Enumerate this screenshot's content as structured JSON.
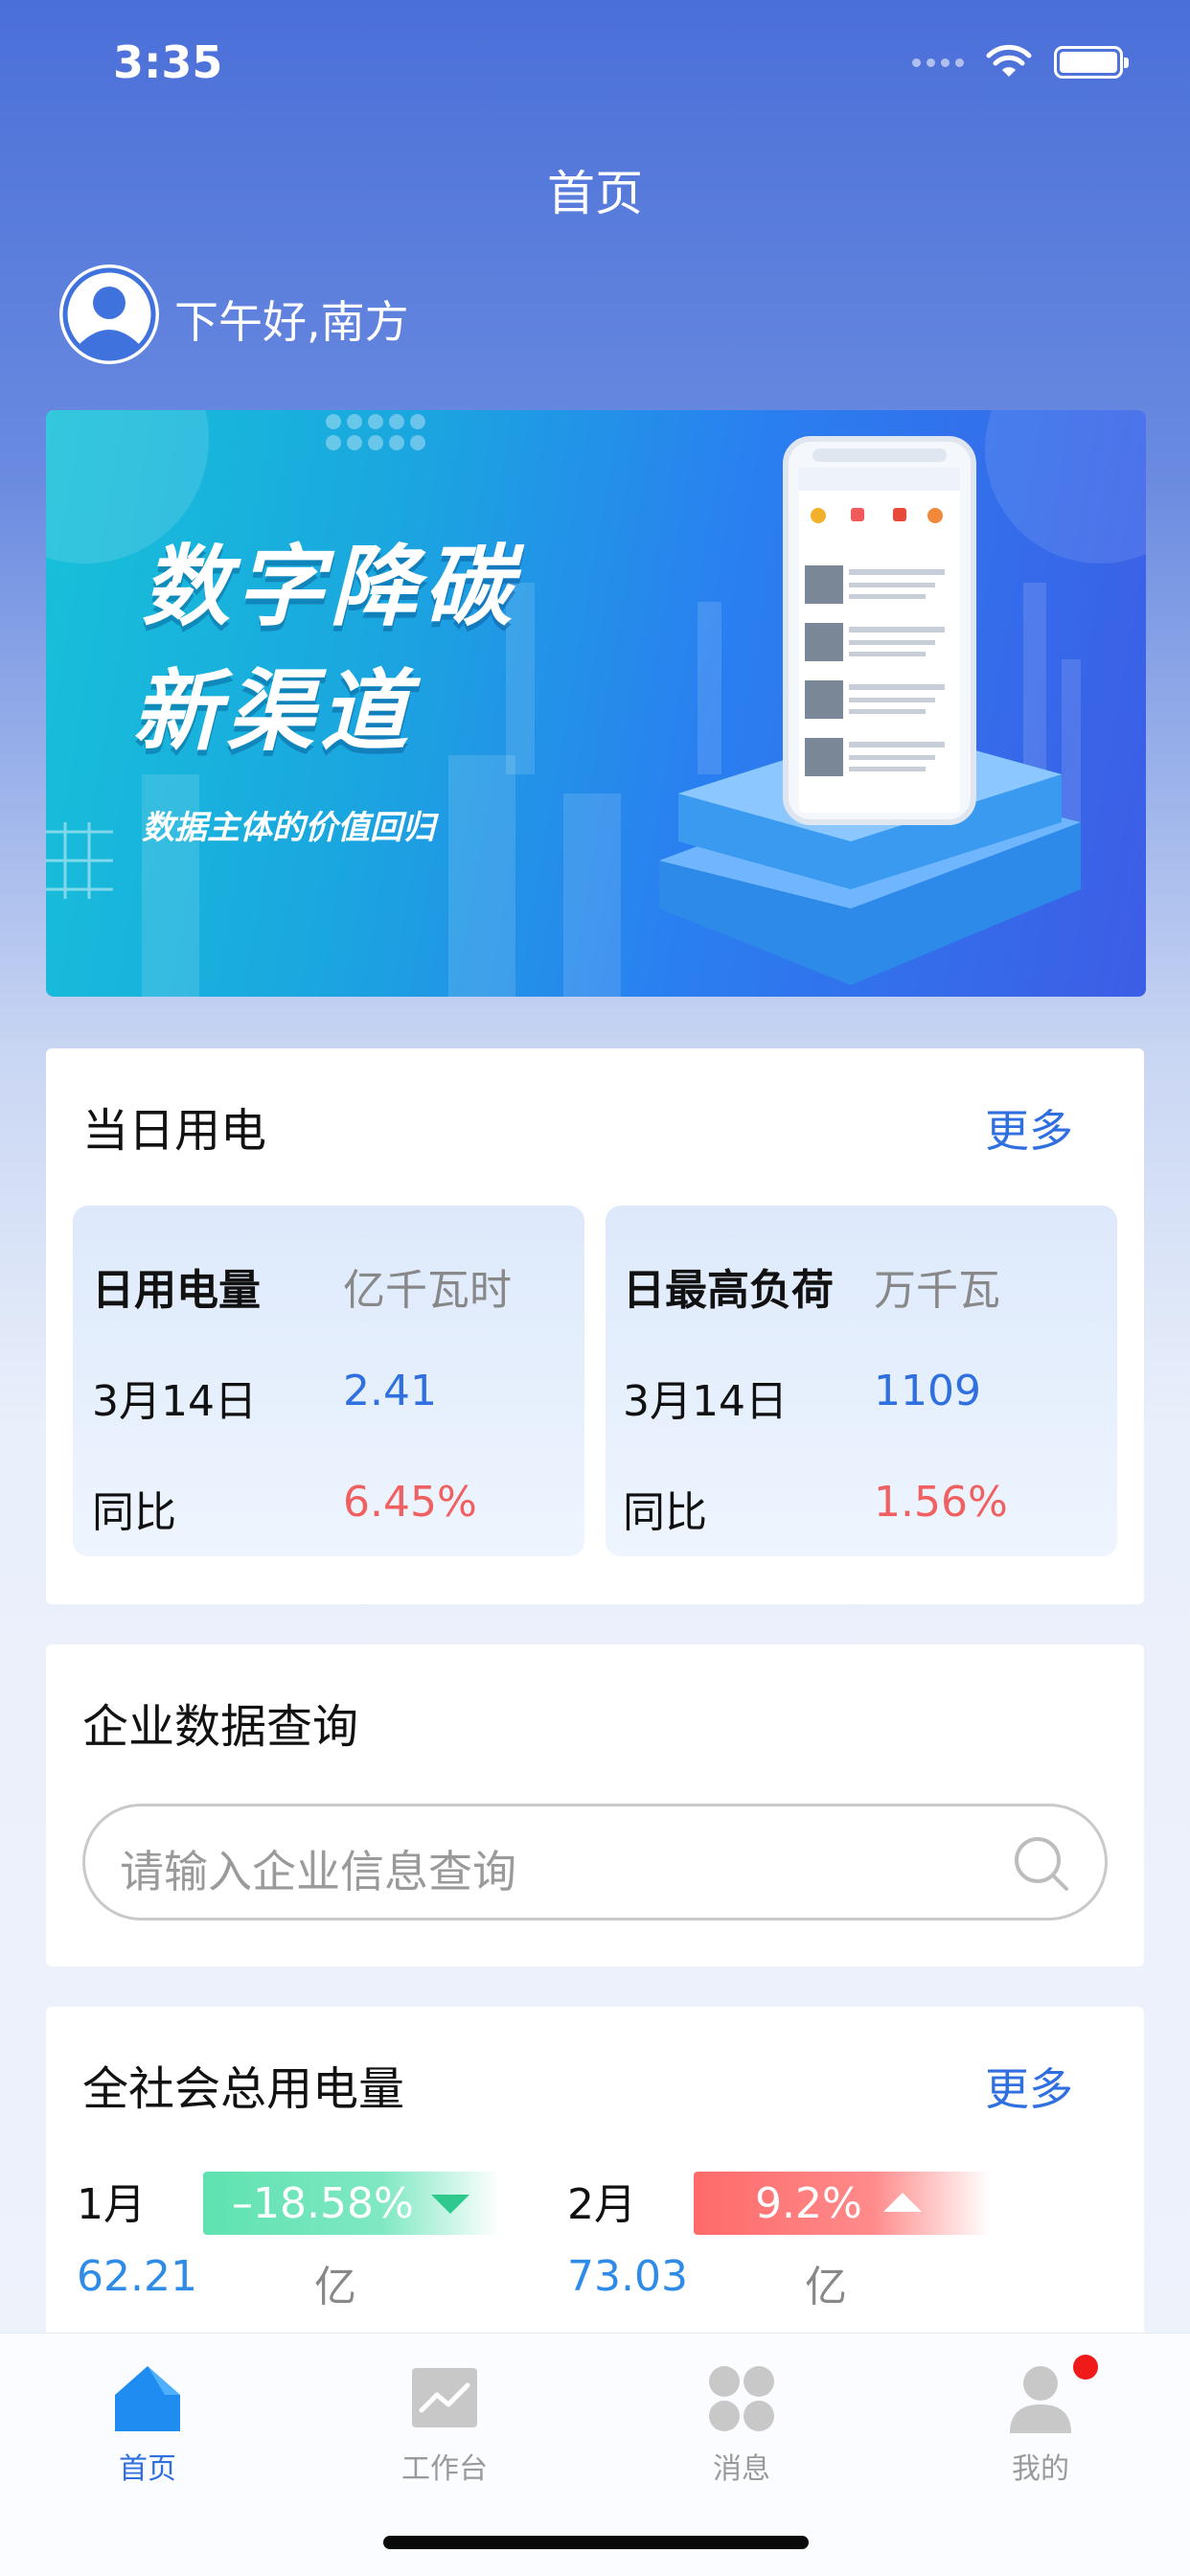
{
  "status": {
    "time": "3:35"
  },
  "header": {
    "title": "首页"
  },
  "user": {
    "greeting": "下午好,南方"
  },
  "banner": {
    "line1": "数字降碳",
    "line2": "新渠道",
    "sub": "数据主体的价值回归"
  },
  "daily": {
    "title": "当日用电",
    "more": "更多",
    "left": {
      "label": "日用电量",
      "unit": "亿千瓦时",
      "date": "3月14日",
      "value": "2.41",
      "yoy_label": "同比",
      "yoy": "6.45%"
    },
    "right": {
      "label": "日最高负荷",
      "unit": "万千瓦",
      "date": "3月14日",
      "value": "1109",
      "yoy_label": "同比",
      "yoy": "1.56%"
    }
  },
  "query": {
    "title": "企业数据查询",
    "placeholder": "请输入企业信息查询"
  },
  "society": {
    "title": "全社会总用电量",
    "more": "更多",
    "items": [
      {
        "month": "1月",
        "change": "–18.58%",
        "value": "62.21",
        "unit": "亿",
        "trend": "down",
        "color": "#5fe2b0"
      },
      {
        "month": "2月",
        "change": "9.2%",
        "value": "73.03",
        "unit": "亿",
        "trend": "up",
        "color": "#ff6a6a"
      }
    ]
  },
  "tabs": [
    {
      "label": "首页",
      "icon": "home-icon",
      "active": true
    },
    {
      "label": "工作台",
      "icon": "workbench-icon",
      "active": false
    },
    {
      "label": "消息",
      "icon": "message-icon",
      "active": false
    },
    {
      "label": "我的",
      "icon": "profile-icon",
      "active": false
    }
  ],
  "colors": {
    "accent": "#2f6fe0",
    "up": "#f06060",
    "down": "#5fe2b0"
  }
}
